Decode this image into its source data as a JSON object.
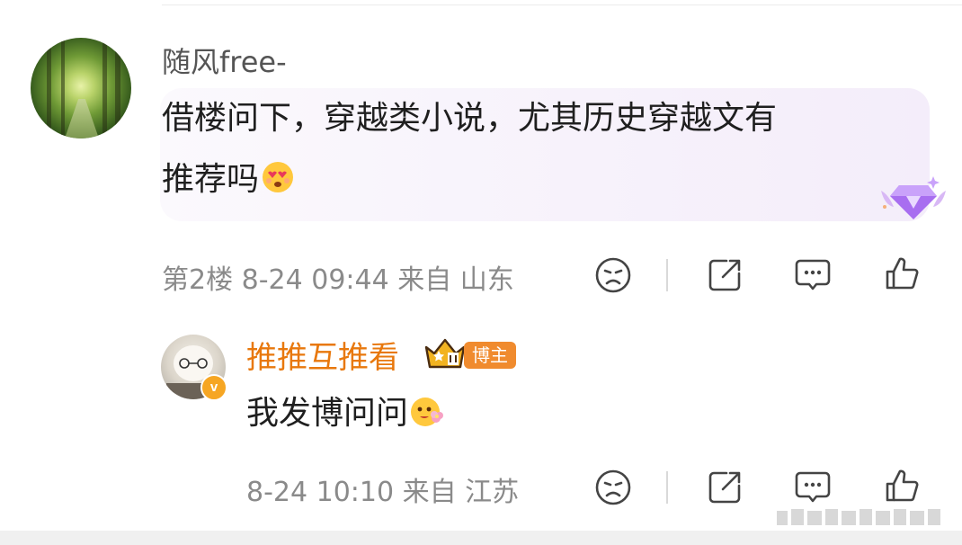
{
  "comment": {
    "username": "随风free-",
    "text_line1": "借楼问下，穿越类小说，尤其历史穿越文有",
    "text_line2": "推荐吗",
    "emoji": "heart-eyes-emoji",
    "floor": "第2楼",
    "timestamp": "8-24 09:44",
    "location": "来自 山东"
  },
  "reply": {
    "username": "推推互推看",
    "tag": "博主",
    "verified_icon": "v",
    "text": "我发博问问",
    "emoji": "blushing-flower-emoji",
    "timestamp": "8-24 10:10",
    "location": "来自 江苏"
  },
  "icons": [
    "sad-face-icon",
    "share-icon",
    "comment-icon",
    "like-icon"
  ],
  "colors": {
    "reply_name": "#e8780d",
    "tag_bg": "#f08b2e",
    "meta_text": "#8a8a8a",
    "bubble": "#f6f0fa"
  }
}
